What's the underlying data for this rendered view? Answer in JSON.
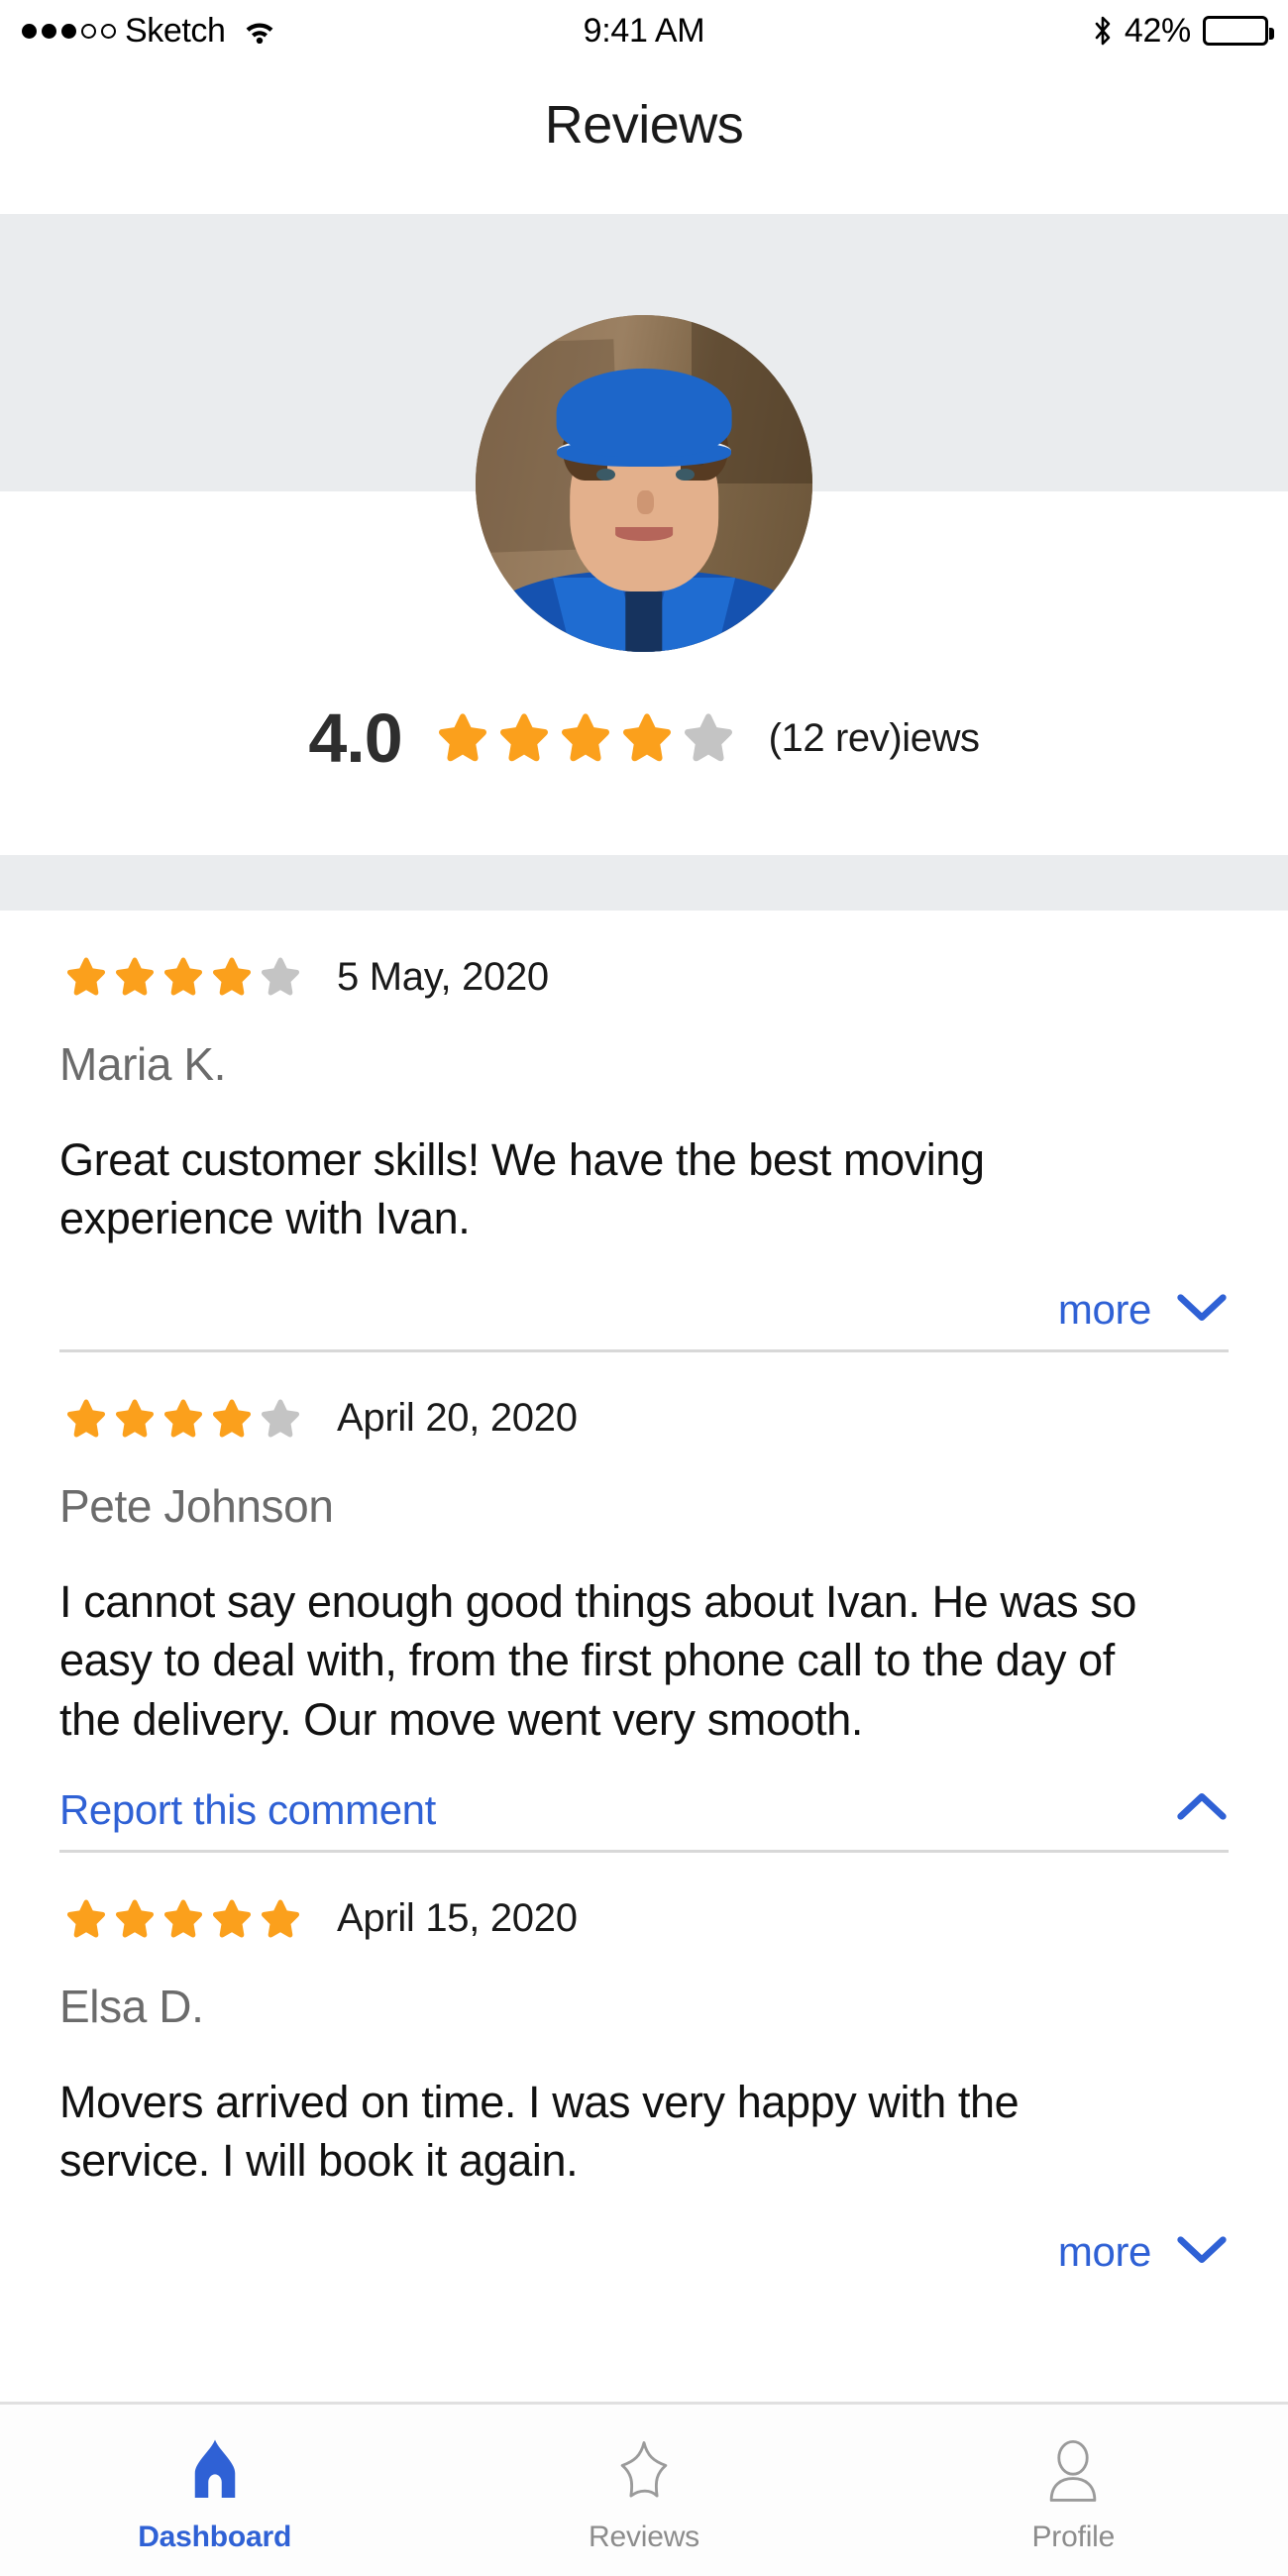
{
  "status_bar": {
    "carrier": "Sketch",
    "signal_dots_filled": 3,
    "signal_dots_total": 5,
    "wifi_icon": "wifi-icon",
    "time": "9:41 AM",
    "bluetooth_icon": "bluetooth-icon",
    "battery_percent": "42%",
    "battery_level": 42
  },
  "header": {
    "title": "Reviews"
  },
  "provider": {
    "avatar_alt": "mover-portrait-blue-cap",
    "rating_score": "4.0",
    "rating_stars_filled": 4,
    "rating_stars_total": 5,
    "review_count_text": "(12 rev)iews"
  },
  "reviews": [
    {
      "stars_filled": 4,
      "stars_total": 5,
      "date": "5 May, 2020",
      "author": "Maria K.",
      "body": "Great customer skills! We have the best moving experience with Ivan.",
      "expanded": false,
      "action_label": "more",
      "chevron": "chevron-down-icon"
    },
    {
      "stars_filled": 4,
      "stars_total": 5,
      "date": "April 20, 2020",
      "author": "Pete Johnson",
      "body": "I cannot say enough good things about Ivan. He was so easy to deal with, from the first phone call to the day of the delivery. Our move went very smooth.",
      "expanded": true,
      "action_label": "Report this comment",
      "chevron": "chevron-up-icon"
    },
    {
      "stars_filled": 5,
      "stars_total": 5,
      "date": "April 15, 2020",
      "author": "Elsa D.",
      "body": "Movers arrived on time. I was very happy with the service. I will book it again.",
      "expanded": false,
      "action_label": "more",
      "chevron": "chevron-down-icon"
    }
  ],
  "tab_bar": {
    "items": [
      {
        "label": "Dashboard",
        "icon": "home-icon",
        "active": true
      },
      {
        "label": "Reviews",
        "icon": "star-icon",
        "active": false
      },
      {
        "label": "Profile",
        "icon": "person-icon",
        "active": false
      }
    ]
  },
  "colors": {
    "star_filled": "#FBA01C",
    "star_empty": "#C4C4C4",
    "accent_blue": "#2F61D5",
    "band_gray": "#EAECEE",
    "name_gray": "#6B6B6B",
    "tab_inactive": "#8C8C8C"
  }
}
